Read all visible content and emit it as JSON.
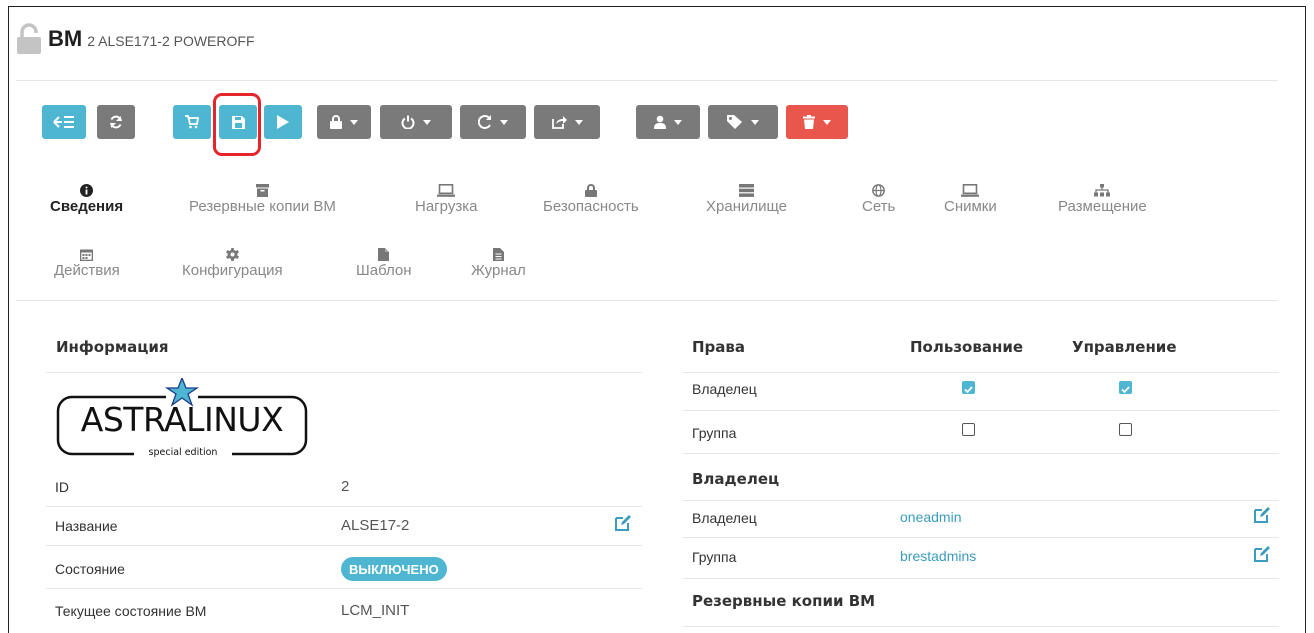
{
  "header": {
    "title": "ВМ",
    "subtitle": "2 ALSE171-2 POWEROFF",
    "icon": "unlock-icon"
  },
  "toolbar": {
    "buttons": [
      {
        "name": "back-to-list-button",
        "icon": "back-list-icon",
        "color": "#4fb6d1"
      },
      {
        "name": "refresh-button",
        "icon": "refresh-icon",
        "color": "#7a7a7a"
      },
      {
        "name": "deploy-button",
        "icon": "cart-icon",
        "color": "#4fb6d1"
      },
      {
        "name": "save-button",
        "icon": "floppy-icon",
        "color": "#4fb6d1",
        "highlighted": true
      },
      {
        "name": "play-button",
        "icon": "play-icon",
        "color": "#4fb6d1"
      },
      {
        "name": "lock-dropdown",
        "icon": "lock-icon",
        "color": "#7a7a7a"
      },
      {
        "name": "power-dropdown",
        "icon": "power-icon",
        "color": "#7a7a7a"
      },
      {
        "name": "reboot-dropdown",
        "icon": "reboot-icon",
        "color": "#7a7a7a"
      },
      {
        "name": "share-dropdown",
        "icon": "share-icon",
        "color": "#7a7a7a"
      },
      {
        "name": "user-dropdown",
        "icon": "user-icon",
        "color": "#7a7a7a"
      },
      {
        "name": "tag-dropdown",
        "icon": "tag-icon",
        "color": "#7a7a7a"
      },
      {
        "name": "delete-dropdown",
        "icon": "trash-icon",
        "color": "#e9574c"
      }
    ]
  },
  "tabs": [
    {
      "label": "Сведения",
      "icon": "info-icon",
      "active": true
    },
    {
      "label": "Резервные копии ВМ",
      "icon": "archive-icon"
    },
    {
      "label": "Нагрузка",
      "icon": "laptop-icon"
    },
    {
      "label": "Безопасность",
      "icon": "lock-icon"
    },
    {
      "label": "Хранилище",
      "icon": "storage-icon"
    },
    {
      "label": "Сеть",
      "icon": "globe-icon"
    },
    {
      "label": "Снимки",
      "icon": "laptop-icon"
    },
    {
      "label": "Размещение",
      "icon": "sitemap-icon"
    },
    {
      "label": "Действия",
      "icon": "calendar-icon"
    },
    {
      "label": "Конфигурация",
      "icon": "cog-icon"
    },
    {
      "label": "Шаблон",
      "icon": "file-icon"
    },
    {
      "label": "Журнал",
      "icon": "file-text-icon"
    }
  ],
  "info": {
    "title": "Информация",
    "logo_text": "ASTRALINUX",
    "logo_sub": "special edition",
    "rows": [
      {
        "label": "ID",
        "value": "2"
      },
      {
        "label": "Название",
        "value": "ALSE17-2"
      },
      {
        "label": "Состояние",
        "value": "ВЫКЛЮЧЕНО"
      },
      {
        "label": "Текущее состояние ВМ",
        "value": "LCM_INIT"
      }
    ]
  },
  "permissions": {
    "title": "Права",
    "col_use": "Пользование",
    "col_manage": "Управление",
    "rows": [
      {
        "label": "Владелец",
        "use": true,
        "manage": true
      },
      {
        "label": "Группа",
        "use": false,
        "manage": false
      }
    ]
  },
  "ownership": {
    "title": "Владелец",
    "rows": [
      {
        "label": "Владелец",
        "value": "oneadmin"
      },
      {
        "label": "Группа",
        "value": "brestadmins"
      }
    ]
  },
  "backups": {
    "title": "Резервные копии ВМ"
  },
  "colors": {
    "accent": "#4fb6d1",
    "gray": "#7a7a7a",
    "danger": "#e9574c",
    "link": "#3b9cbf",
    "highlight": "#e4262c"
  }
}
